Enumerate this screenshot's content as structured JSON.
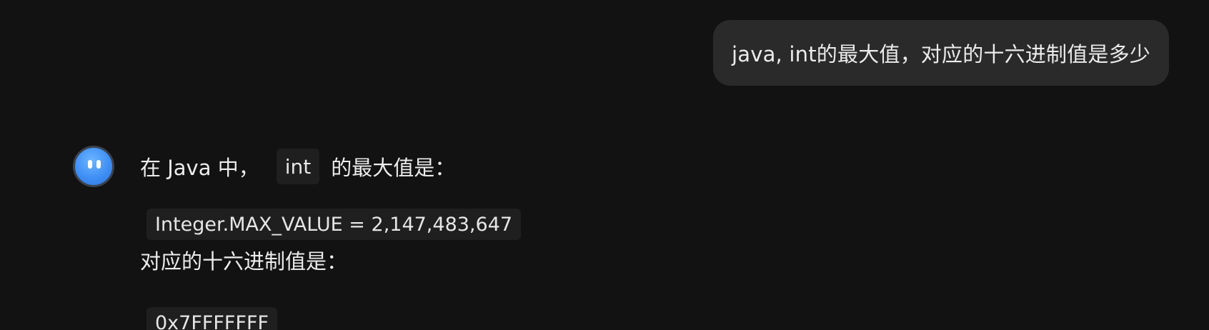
{
  "user_message": {
    "text": "java, int的最大值，对应的十六进制值是多少"
  },
  "assistant_message": {
    "intro_prefix": "在 Java 中，",
    "intro_code": "int",
    "intro_suffix": "的最大值是：",
    "max_value_code": "Integer.MAX_VALUE = 2,147,483,647",
    "hex_label": "对应的十六进制值是：",
    "hex_value_code": "0x7FFFFFFF"
  },
  "avatar": {
    "icon": "assistant-avatar-icon",
    "color": "#3f8ff5"
  },
  "colors": {
    "background": "#121212",
    "user_bubble": "#2a2a2a",
    "code_background": "#1f1f1f",
    "text": "#ececec"
  }
}
